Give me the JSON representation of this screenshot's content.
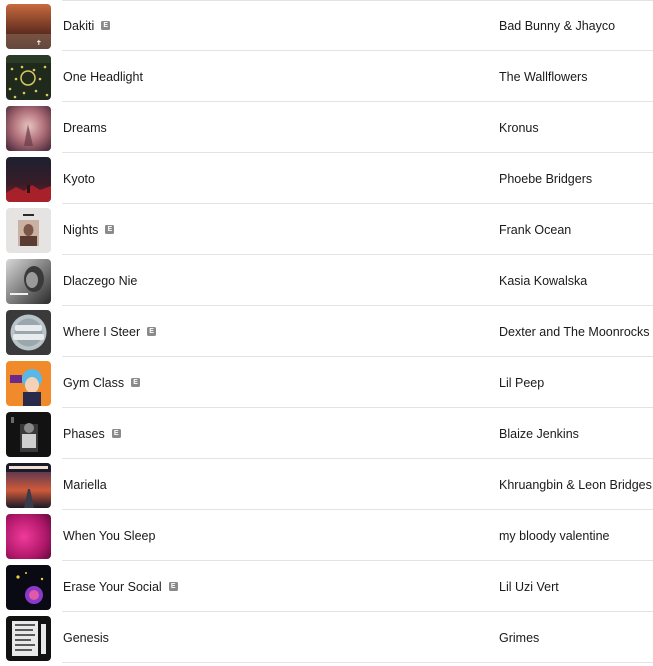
{
  "explicit_label": "E",
  "tracks": [
    {
      "title": "Dakiti",
      "artist": "Bad Bunny & Jhayco",
      "explicit": true,
      "art_icon": "album-art-dakiti"
    },
    {
      "title": "One Headlight",
      "artist": "The Wallflowers",
      "explicit": false,
      "art_icon": "album-art-bringing-down-the-horse"
    },
    {
      "title": "Dreams",
      "artist": "Kronus",
      "explicit": false,
      "art_icon": "album-art-dreams"
    },
    {
      "title": "Kyoto",
      "artist": "Phoebe Bridgers",
      "explicit": false,
      "art_icon": "album-art-punisher"
    },
    {
      "title": "Nights",
      "artist": "Frank Ocean",
      "explicit": true,
      "art_icon": "album-art-blond"
    },
    {
      "title": "Dlaczego Nie",
      "artist": "Kasia Kowalska",
      "explicit": false,
      "art_icon": "album-art-kasia-kowalska"
    },
    {
      "title": "Where I Steer",
      "artist": "Dexter and The Moonrocks",
      "explicit": true,
      "art_icon": "album-art-dexter-moonrocks"
    },
    {
      "title": "Gym Class",
      "artist": "Lil Peep",
      "explicit": true,
      "art_icon": "album-art-come-over-when-youre-sober"
    },
    {
      "title": "Phases",
      "artist": "Blaize Jenkins",
      "explicit": true,
      "art_icon": "album-art-phases"
    },
    {
      "title": "Mariella",
      "artist": "Khruangbin & Leon Bridges",
      "explicit": false,
      "art_icon": "album-art-texas-moon"
    },
    {
      "title": "When You Sleep",
      "artist": "my bloody valentine",
      "explicit": false,
      "art_icon": "album-art-loveless"
    },
    {
      "title": "Erase Your Social",
      "artist": "Lil Uzi Vert",
      "explicit": true,
      "art_icon": "album-art-luv-is-rage"
    },
    {
      "title": "Genesis",
      "artist": "Grimes",
      "explicit": false,
      "art_icon": "album-art-visions"
    }
  ]
}
